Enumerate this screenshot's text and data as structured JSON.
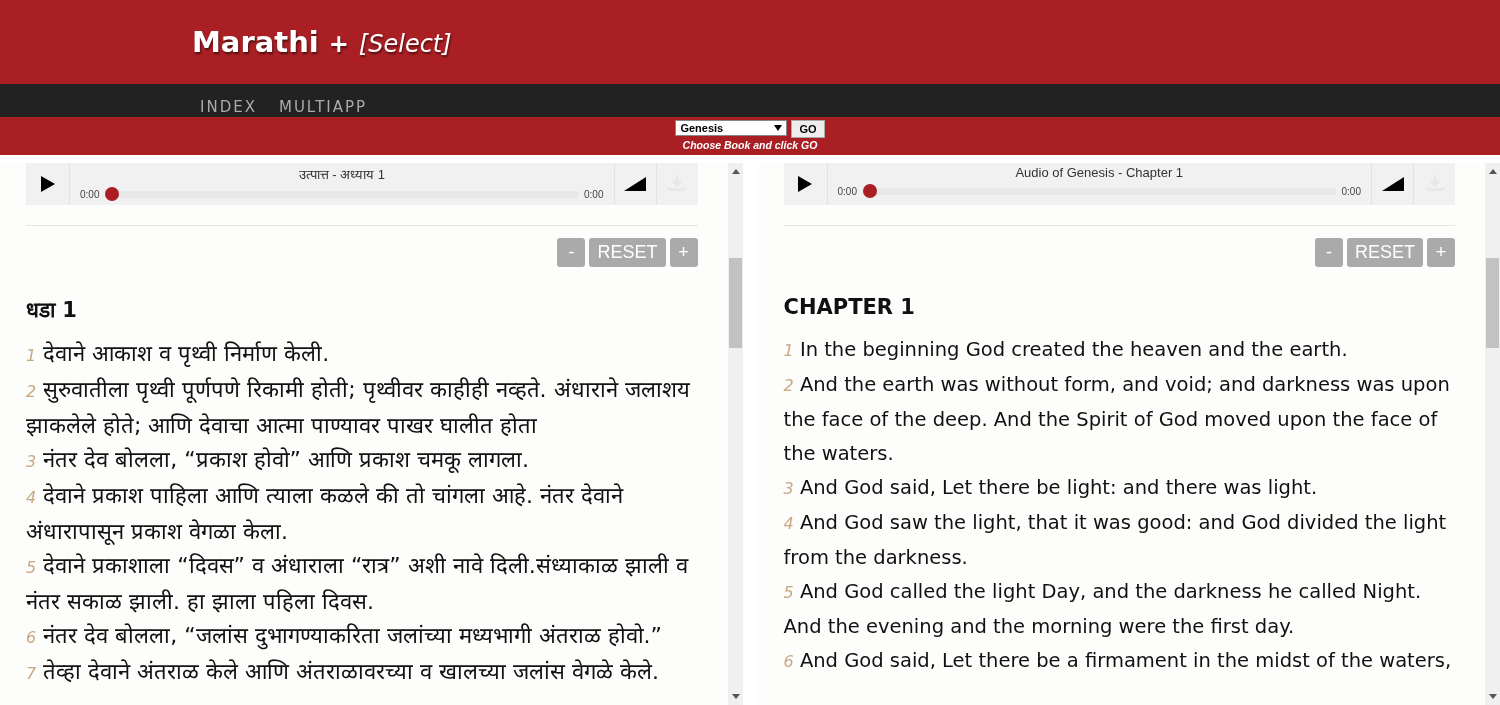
{
  "header": {
    "title": "Marathi",
    "plus": "+",
    "select_link": "[Select]"
  },
  "nav": [
    {
      "label": "INDEX"
    },
    {
      "label": "MULTIAPP"
    }
  ],
  "book_picker": {
    "value": "Genesis",
    "button": "GO",
    "hint": "Choose Book and click GO"
  },
  "panels": [
    {
      "audio": {
        "title": "उत्पात्त - अध्याय 1",
        "elapsed": "0:00",
        "duration": "0:00",
        "level": 0
      },
      "zoom_buttons": [
        "-",
        "RESET",
        "+"
      ],
      "heading": "धडा 1",
      "verses": [
        {
          "number": "1",
          "text": "देवाने आकाश व पृथ्वी निर्माण केली."
        },
        {
          "number": "2",
          "text": "सुरुवातीला पृथ्वी पूर्णपणे रिकामी होती; पृथ्वीवर काहीही नव्हते. अंधाराने जलाशय झाकलेले होते; आणि देवाचा आत्मा पाण्यावर पाखर घालीत होता"
        },
        {
          "number": "3",
          "text": "नंतर देव बोलला, “प्रकाश होवो” आणि प्रकाश चमकू लागला."
        },
        {
          "number": "4",
          "text": "देवाने प्रकाश पाहिला आणि त्याला कळले की तो चांगला आहे. नंतर देवाने अंधारापासून प्रकाश वेगळा केला."
        },
        {
          "number": "5",
          "text": "देवाने प्रकाशाला “दिवस” व अंधाराला “रात्र” अशी नावे दिली.संध्याकाळ झाली व नंतर सकाळ झाली. हा झाला पहिला दिवस."
        },
        {
          "number": "6",
          "text": "नंतर देव बोलला, “जलांस दुभागण्याकरिता जलांच्या मध्यभागी अंतराळ होवो.”"
        },
        {
          "number": "7",
          "text": "तेव्हा देवाने अंतराळ केले आणि अंतराळावरच्या व खालच्या जलांस वेगळे केले."
        }
      ]
    },
    {
      "audio": {
        "title": "Audio of Genesis - Chapter 1",
        "elapsed": "0:00",
        "duration": "0:00",
        "level": 0
      },
      "zoom_buttons": [
        "-",
        "RESET",
        "+"
      ],
      "heading": "CHAPTER 1",
      "verses": [
        {
          "number": "1",
          "text": "In the beginning God created the heaven and the earth."
        },
        {
          "number": "2",
          "text": "And the earth was without form, and void; and darkness was upon the face of the deep. And the Spirit of God moved upon the face of the waters."
        },
        {
          "number": "3",
          "text": "And God said, Let there be light: and there was light."
        },
        {
          "number": "4",
          "text": "And God saw the light, that it was good: and God divided the light from the darkness."
        },
        {
          "number": "5",
          "text": "And God called the light Day, and the darkness he called Night. And the evening and the morning were the first day."
        },
        {
          "number": "6",
          "text": "And God said, Let there be a firmament in the midst of the waters,"
        }
      ]
    }
  ]
}
